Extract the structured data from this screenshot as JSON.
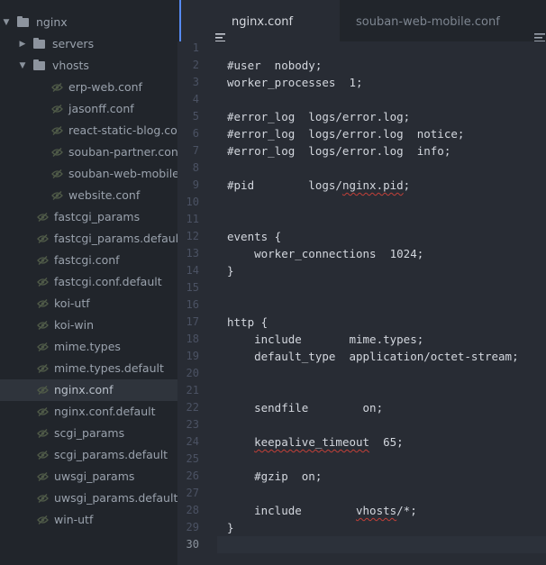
{
  "sidebar": {
    "items": [
      {
        "label": "nginx",
        "kind": "folder",
        "expanded": true,
        "depth": 0
      },
      {
        "label": "servers",
        "kind": "folder",
        "expanded": false,
        "depth": 1
      },
      {
        "label": "vhosts",
        "kind": "folder",
        "expanded": true,
        "depth": 1
      },
      {
        "label": "erp-web.conf",
        "kind": "file",
        "depth": 2
      },
      {
        "label": "jasonff.conf",
        "kind": "file",
        "depth": 2
      },
      {
        "label": "react-static-blog.conf",
        "kind": "file",
        "depth": 2
      },
      {
        "label": "souban-partner.conf",
        "kind": "file",
        "depth": 2
      },
      {
        "label": "souban-web-mobile.conf",
        "kind": "file",
        "depth": 2
      },
      {
        "label": "website.conf",
        "kind": "file",
        "depth": 2
      },
      {
        "label": "fastcgi_params",
        "kind": "file",
        "depth": 1
      },
      {
        "label": "fastcgi_params.default",
        "kind": "file",
        "depth": 1
      },
      {
        "label": "fastcgi.conf",
        "kind": "file",
        "depth": 1
      },
      {
        "label": "fastcgi.conf.default",
        "kind": "file",
        "depth": 1
      },
      {
        "label": "koi-utf",
        "kind": "file",
        "depth": 1
      },
      {
        "label": "koi-win",
        "kind": "file",
        "depth": 1
      },
      {
        "label": "mime.types",
        "kind": "file",
        "depth": 1
      },
      {
        "label": "mime.types.default",
        "kind": "file",
        "depth": 1
      },
      {
        "label": "nginx.conf",
        "kind": "file",
        "depth": 1,
        "selected": true
      },
      {
        "label": "nginx.conf.default",
        "kind": "file",
        "depth": 1
      },
      {
        "label": "scgi_params",
        "kind": "file",
        "depth": 1
      },
      {
        "label": "scgi_params.default",
        "kind": "file",
        "depth": 1
      },
      {
        "label": "uwsgi_params",
        "kind": "file",
        "depth": 1
      },
      {
        "label": "uwsgi_params.default",
        "kind": "file",
        "depth": 1
      },
      {
        "label": "win-utf",
        "kind": "file",
        "depth": 1
      }
    ]
  },
  "tabs": {
    "active": {
      "label": "nginx.conf",
      "icon": "file-text-icon"
    },
    "inactive": {
      "label": "souban-web-mobile.conf",
      "icon": "file-text-icon"
    },
    "more": {
      "icon": "file-text-icon"
    }
  },
  "editor": {
    "active_line": 30,
    "lines": [
      "",
      "#user  nobody;",
      "worker_processes  1;",
      "",
      "#error_log  logs/error.log;",
      "#error_log  logs/error.log  notice;",
      "#error_log  logs/error.log  info;",
      "",
      "#pid        logs/nginx.pid;",
      "",
      "",
      "events {",
      "    worker_connections  1024;",
      "}",
      "",
      "",
      "http {",
      "    include       mime.types;",
      "    default_type  application/octet-stream;",
      "",
      "",
      "    sendfile        on;",
      "",
      "    keepalive_timeout  65;",
      "",
      "    #gzip  on;",
      "",
      "    include        vhosts/*;",
      "}",
      ""
    ],
    "misspelled": [
      {
        "line": 9,
        "word": "nginx.pid"
      },
      {
        "line": 24,
        "word": "keepalive_timeout"
      },
      {
        "line": 28,
        "word": "vhosts"
      }
    ]
  },
  "colors": {
    "sidebar_bg": "#21252b",
    "editor_bg": "#282c34",
    "accent": "#568af2",
    "text": "#d3d7de",
    "gutter_text": "#4b5263",
    "spell_underline": "#c24038"
  }
}
